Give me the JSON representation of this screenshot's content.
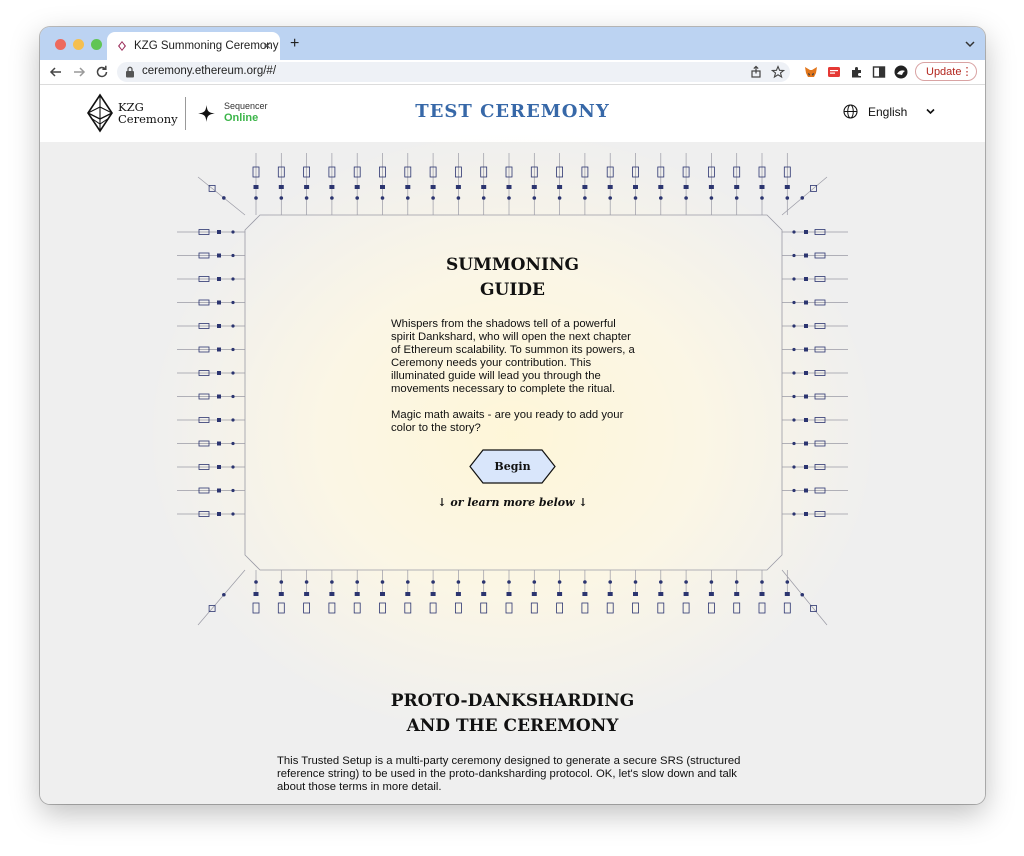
{
  "browser": {
    "tab_title": "KZG Summoning Ceremony",
    "url": "ceremony.ethereum.org/#/",
    "update_label": "Update",
    "colors": {
      "tabstrip": "#bcd3f2",
      "update_text": "#b3261e"
    }
  },
  "header": {
    "logo_line1": "KZG",
    "logo_line2": "Ceremony",
    "sequencer_label": "Sequencer",
    "sequencer_status": "Online",
    "title": "TEST CEREMONY",
    "language": "English",
    "colors": {
      "title": "#3768a8",
      "status": "#3cb54a"
    }
  },
  "guide": {
    "title_line1": "SUMMONING",
    "title_line2": "GUIDE",
    "paragraph1": "Whispers from the shadows tell of a powerful spirit Dankshard, who will open the next chapter of Ethereum scalability. To summon its powers, a Ceremony needs your contribution. This illuminated guide will lead you through the movements necessary to complete the ritual.",
    "paragraph2": "Magic math awaits - are you ready to add your color to the story?",
    "begin_label": "Begin",
    "learn_more": "↓ or learn more below ↓",
    "colors": {
      "button_fill": "#d9e6fb",
      "circuit": "#2c3570"
    }
  },
  "proto": {
    "title_line1": "PROTO-DANKSHARDING",
    "title_line2": "AND THE CEREMONY",
    "paragraph": "This Trusted Setup is a multi-party ceremony designed to generate a secure SRS (structured reference string) to be used in the proto-danksharding protocol. OK, let's slow down and talk about those terms in more detail."
  }
}
